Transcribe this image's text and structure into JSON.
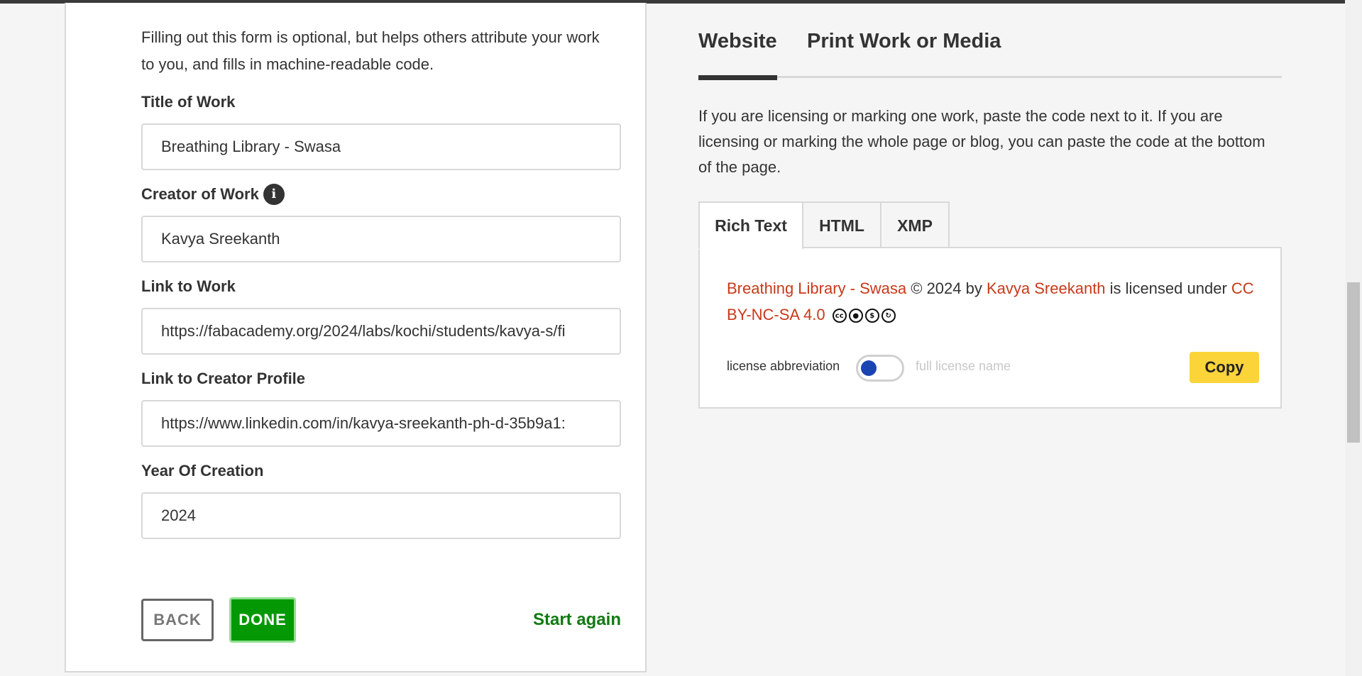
{
  "form": {
    "intro": "Filling out this form is optional, but helps others attribute your work to you, and fills in machine-readable code.",
    "fields": [
      {
        "label": "Title of Work",
        "value": "Breathing Library - Swasa"
      },
      {
        "label": "Creator of Work",
        "value": "Kavya Sreekanth"
      },
      {
        "label": "Link to Work",
        "value": "https://fabacademy.org/2024/labs/kochi/students/kavya-s/fi"
      },
      {
        "label": "Link to Creator Profile",
        "value": "https://www.linkedin.com/in/kavya-sreekanth-ph-d-35b9a1:"
      },
      {
        "label": "Year Of Creation",
        "value": "2024"
      }
    ],
    "info_icon": "info-icon",
    "back_label": "BACK",
    "done_label": "DONE",
    "start_again_label": "Start again"
  },
  "right": {
    "tabs": [
      {
        "label": "Website",
        "active": true
      },
      {
        "label": "Print Work or Media",
        "active": false
      }
    ],
    "instructions": "If you are licensing or marking one work, paste the code next to it. If you are licensing or marking the whole page or blog, you can paste the code at the bottom of the page.",
    "code_tabs": [
      {
        "label": "Rich Text",
        "active": true
      },
      {
        "label": "HTML",
        "active": false
      },
      {
        "label": "XMP",
        "active": false
      }
    ],
    "attribution": {
      "work_title": "Breathing Library - Swasa",
      "copyright_text": "© 2024 by",
      "creator": "Kavya Sreekanth",
      "licensed_text": "is licensed under",
      "license": "CC BY-NC-SA 4.0",
      "license_icons": [
        "cc-icon",
        "by-icon",
        "nc-icon",
        "sa-icon"
      ]
    },
    "toggle": {
      "left_label": "license abbreviation",
      "right_label": "full license name"
    },
    "copy_label": "Copy"
  },
  "colors": {
    "link": "#c8391a",
    "done": "#049904",
    "copy": "#fbd43a",
    "toggle_knob": "#1b44b3"
  }
}
